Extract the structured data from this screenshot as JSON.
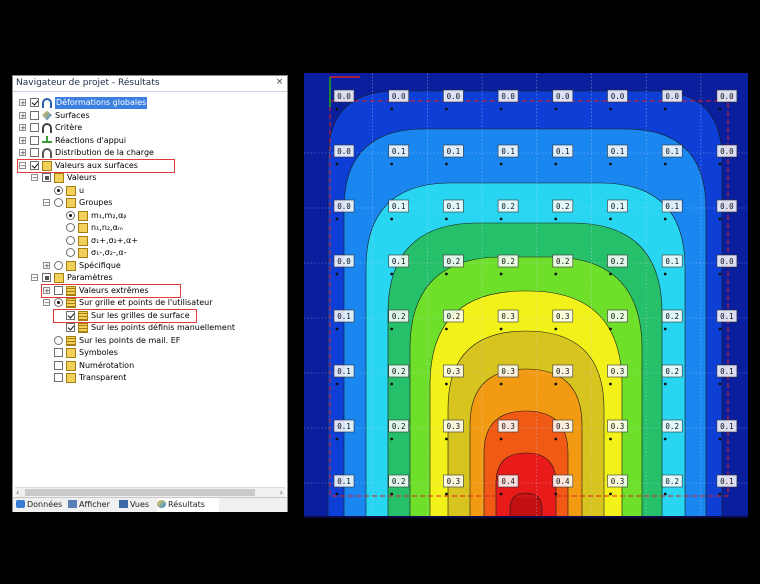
{
  "navigator": {
    "title": "Navigateur de projet - Résultats",
    "close": "×",
    "items": [
      {
        "label": "Déformations globales",
        "icon": "deform-icon"
      },
      {
        "label": "Surfaces",
        "icon": "surface-icon"
      },
      {
        "label": "Critère",
        "icon": "criterion-icon"
      },
      {
        "label": "Réactions d'appui",
        "icon": "support-icon"
      },
      {
        "label": "Distribution de la charge",
        "icon": "load-icon"
      },
      {
        "label": "Valeurs aux surfaces",
        "icon": "folder-icon"
      },
      {
        "label": "Valeurs",
        "icon": "folder-icon"
      },
      {
        "label": "u",
        "icon": "folder-icon"
      },
      {
        "label": "Groupes",
        "icon": "folder-icon"
      },
      {
        "label": "m₁,m₂,αᵦ",
        "icon": "folder-icon"
      },
      {
        "label": "n₁,n₂,αₘ",
        "icon": "folder-icon"
      },
      {
        "label": "σ₁+,σ₂+,α+",
        "icon": "folder-icon"
      },
      {
        "label": "σ₁-,σ₂-,α-",
        "icon": "folder-icon"
      },
      {
        "label": "Spécifique",
        "icon": "folder-icon"
      },
      {
        "label": "Paramètres",
        "icon": "folder-icon"
      },
      {
        "label": "Valeurs extrêmes",
        "icon": "grid-icon"
      },
      {
        "label": "Sur grille et points de l'utilisateur",
        "icon": "grid-icon"
      },
      {
        "label": "Sur les grilles de surface",
        "icon": "grid-icon"
      },
      {
        "label": "Sur les points définis manuellement",
        "icon": "grid-icon"
      },
      {
        "label": "Sur les points de mail. EF",
        "icon": "grid-icon"
      },
      {
        "label": "Symboles",
        "icon": "folder-icon"
      },
      {
        "label": "Numérotation",
        "icon": "folder-icon"
      },
      {
        "label": "Transparent",
        "icon": "folder-icon"
      }
    ],
    "tabs": [
      {
        "label": "Données",
        "icon": "data-icon"
      },
      {
        "label": "Afficher",
        "icon": "display-icon"
      },
      {
        "label": "Vues",
        "icon": "views-icon"
      },
      {
        "label": "Résultats",
        "icon": "results-icon"
      }
    ]
  },
  "plot": {
    "colors": [
      "#0a1f9e",
      "#0d3fd6",
      "#1a86f0",
      "#29d6f2",
      "#27c06a",
      "#6ee02a",
      "#f2f21a",
      "#d8c41e",
      "#f29b12",
      "#f05a14",
      "#e81a1a",
      "#c20f0f"
    ],
    "value_rows": [
      [
        "0.0",
        "0.0",
        "0.0",
        "0.0",
        "0.0",
        "0.0",
        "0.0",
        "0.0"
      ],
      [
        "0.0",
        "0.1",
        "0.1",
        "0.1",
        "0.1",
        "0.1",
        "0.1",
        "0.0"
      ],
      [
        "0.0",
        "0.1",
        "0.1",
        "0.2",
        "0.2",
        "0.1",
        "0.1",
        "0.0"
      ],
      [
        "0.0",
        "0.1",
        "0.2",
        "0.2",
        "0.2",
        "0.2",
        "0.1",
        "0.0"
      ],
      [
        "0.1",
        "0.2",
        "0.2",
        "0.3",
        "0.3",
        "0.2",
        "0.2",
        "0.1"
      ],
      [
        "0.1",
        "0.2",
        "0.3",
        "0.3",
        "0.3",
        "0.3",
        "0.2",
        "0.1"
      ],
      [
        "0.1",
        "0.2",
        "0.3",
        "0.3",
        "0.3",
        "0.3",
        "0.2",
        "0.1"
      ],
      [
        "0.1",
        "0.2",
        "0.3",
        "0.4",
        "0.4",
        "0.3",
        "0.2",
        "0.1"
      ]
    ]
  }
}
